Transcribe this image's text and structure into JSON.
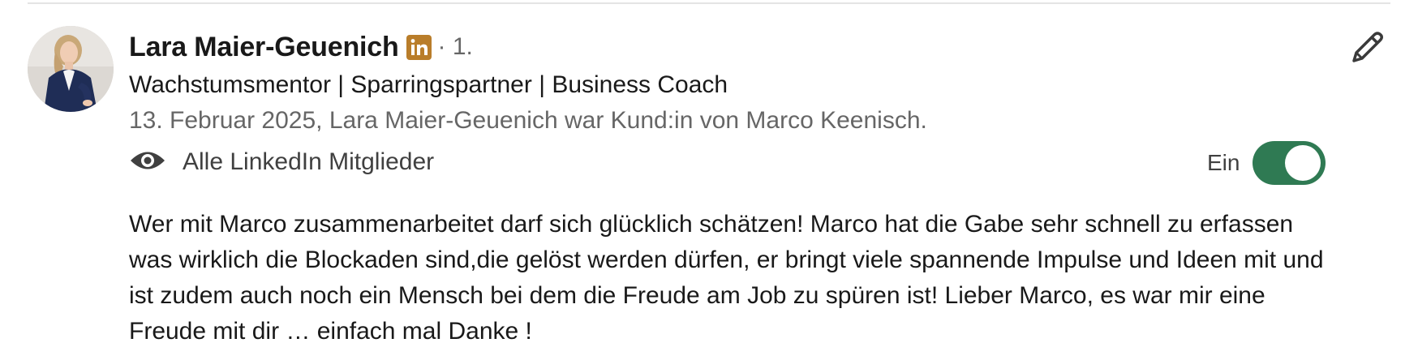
{
  "recommendation": {
    "author_name": "Lara Maier-Geuenich",
    "degree": "· 1.",
    "headline": "Wachstumsmentor | Sparringspartner | Business Coach",
    "meta": "13. Februar 2025, Lara Maier-Geuenich war Kund:in von Marco Keenisch.",
    "visibility_label": "Alle LinkedIn Mitglieder",
    "toggle_label": "Ein",
    "toggle_on": true,
    "text": "Wer mit Marco zusammenarbeitet darf sich glücklich schätzen! Marco hat die Gabe sehr schnell zu erfassen was wirklich die Blockaden sind,die gelöst werden dürfen, er bringt viele spannende Impulse und Ideen mit und ist zudem auch noch ein Mensch bei dem die Freude am Job zu spüren ist! Lieber Marco, es war mir eine Freude mit dir … einfach mal Danke !"
  },
  "icons": {
    "badge": "linkedin-premium-icon",
    "visibility": "eye-icon",
    "edit": "pencil-icon"
  },
  "colors": {
    "badge": "#b97d2a",
    "toggle_on": "#2f7a53",
    "secondary_text": "#666666"
  }
}
